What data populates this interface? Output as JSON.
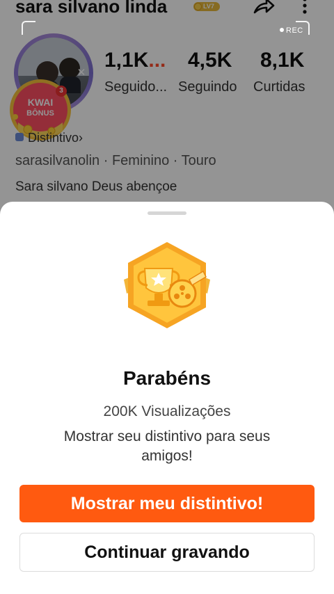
{
  "profile": {
    "username": "sara silvano linda",
    "level_badge": "LV7",
    "stats": [
      {
        "value": "1,1K",
        "suffix": "...",
        "label": "Seguido..."
      },
      {
        "value": "4,5K",
        "suffix": "",
        "label": "Seguindo"
      },
      {
        "value": "8,1K",
        "suffix": "",
        "label": "Curtidas"
      }
    ],
    "distintivo_label": "Distintivo",
    "distintivo_chevron": "›",
    "info": "sarasilvanolin · Feminino · Touro",
    "bio": "Sara silvano Deus abençoe"
  },
  "recording": {
    "label": "REC"
  },
  "kwai_bonus": {
    "line1": "KWAI",
    "line2": "BÔNUS",
    "count": "3",
    "progress": "9/13"
  },
  "sheet": {
    "title": "Parabéns",
    "subtitle": "200K Visualizações",
    "description": "Mostrar seu distintivo para seus amigos!",
    "primary_button": "Mostrar meu distintivo!",
    "secondary_button": "Continuar gravando"
  },
  "icons": {
    "share": "share-arrow-icon",
    "more": "vertical-dots-icon",
    "close": "close-icon",
    "badge": "trophy-film-badge-icon"
  },
  "colors": {
    "accent": "#ff5a10",
    "level": "#e7b93c",
    "badge_gold": "#f7b731"
  }
}
